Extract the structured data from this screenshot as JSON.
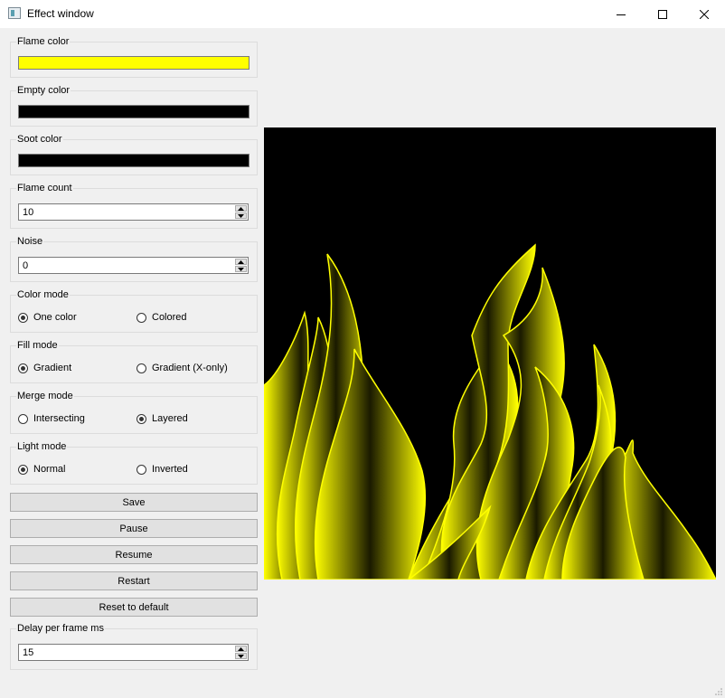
{
  "window": {
    "title": "Effect window",
    "icon": "app-window-icon"
  },
  "controls": {
    "minimize": "minimize-icon",
    "maximize": "maximize-icon",
    "close": "close-icon"
  },
  "colors": {
    "flame_color": {
      "label": "Flame color",
      "value": "#ffff00"
    },
    "empty_color": {
      "label": "Empty color",
      "value": "#000000"
    },
    "soot_color": {
      "label": "Soot color",
      "value": "#000000"
    }
  },
  "flame_count": {
    "label": "Flame count",
    "value": "10"
  },
  "noise": {
    "label": "Noise",
    "value": "0"
  },
  "color_mode": {
    "label": "Color mode",
    "options": [
      "One color",
      "Colored"
    ],
    "selected": "One color"
  },
  "fill_mode": {
    "label": "Fill mode",
    "options": [
      "Gradient",
      "Gradient (X-only)"
    ],
    "selected": "Gradient"
  },
  "merge_mode": {
    "label": "Merge mode",
    "options": [
      "Intersecting",
      "Layered"
    ],
    "selected": "Layered"
  },
  "light_mode": {
    "label": "Light mode",
    "options": [
      "Normal",
      "Inverted"
    ],
    "selected": "Normal"
  },
  "buttons": {
    "save": "Save",
    "pause": "Pause",
    "resume": "Resume",
    "restart": "Restart",
    "reset": "Reset to default"
  },
  "delay": {
    "label": "Delay per frame ms",
    "value": "15"
  },
  "preview": {
    "background": "#000000",
    "flame_color": "#ffff00"
  }
}
